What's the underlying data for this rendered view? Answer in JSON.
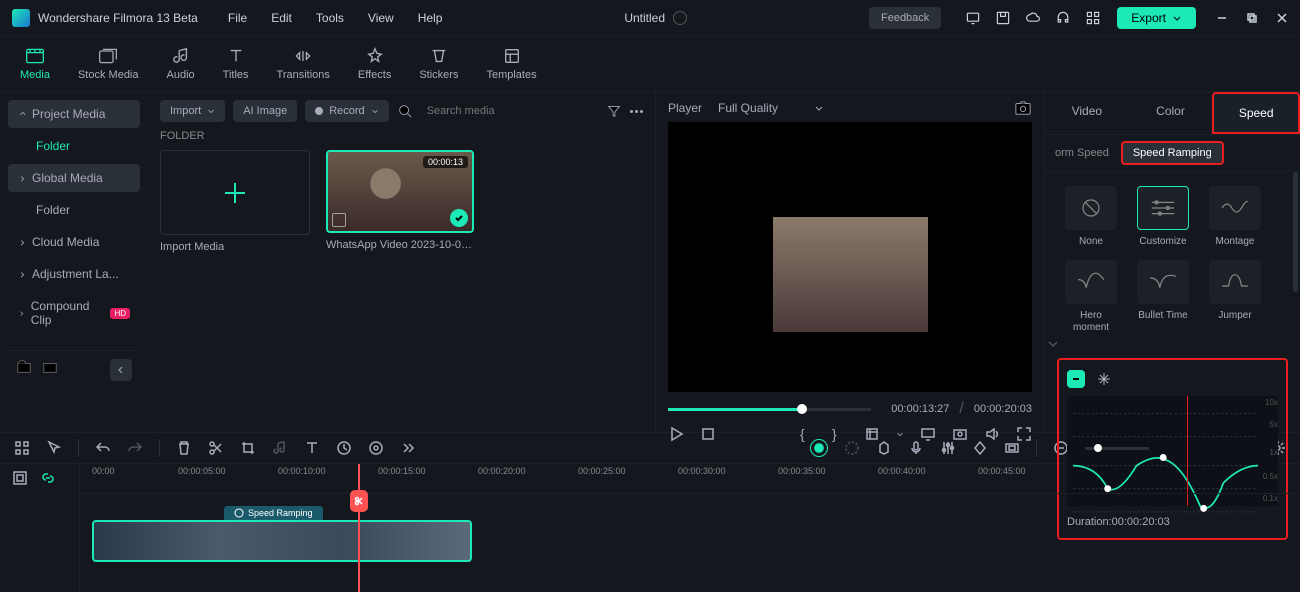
{
  "app": {
    "title": "Wondershare Filmora 13 Beta"
  },
  "menu": [
    "File",
    "Edit",
    "Tools",
    "View",
    "Help"
  ],
  "document": {
    "title": "Untitled"
  },
  "titlebar": {
    "feedback": "Feedback",
    "export": "Export"
  },
  "toolbar": {
    "items": [
      {
        "label": "Media",
        "icon": "media"
      },
      {
        "label": "Stock Media",
        "icon": "stock"
      },
      {
        "label": "Audio",
        "icon": "audio"
      },
      {
        "label": "Titles",
        "icon": "titles"
      },
      {
        "label": "Transitions",
        "icon": "transitions"
      },
      {
        "label": "Effects",
        "icon": "effects"
      },
      {
        "label": "Stickers",
        "icon": "stickers"
      },
      {
        "label": "Templates",
        "icon": "templates"
      }
    ]
  },
  "sidebar": {
    "items": [
      {
        "label": "Project Media"
      },
      {
        "label": "Folder"
      },
      {
        "label": "Global Media"
      },
      {
        "label": "Folder"
      },
      {
        "label": "Cloud Media"
      },
      {
        "label": "Adjustment La..."
      },
      {
        "label": "Compound Clip"
      }
    ]
  },
  "mediabar": {
    "import": "Import",
    "ai_image": "AI Image",
    "record": "Record",
    "search_placeholder": "Search media"
  },
  "media": {
    "folder_label": "FOLDER",
    "import_label": "Import Media",
    "clips": [
      {
        "name": "WhatsApp Video 2023-10-05...",
        "duration": "00:00:13"
      }
    ]
  },
  "player": {
    "label": "Player",
    "quality": "Full Quality",
    "current": "00:00:13:27",
    "total": "00:00:20:03"
  },
  "inspector": {
    "tabs": [
      "Video",
      "Color",
      "Speed"
    ],
    "subtab_left": "orm Speed",
    "subtab_right": "Speed Ramping",
    "presets": [
      "None",
      "Customize",
      "Montage",
      "Hero moment",
      "Bullet Time",
      "Jumper"
    ],
    "graph_labels": [
      "10x",
      "5x",
      "1x",
      "0.5x",
      "0.1x"
    ],
    "duration_label": "Duration:",
    "duration_value": "00:00:20:03"
  },
  "timeline": {
    "ruler": [
      "00:00",
      "00:00:05:00",
      "00:00:10:00",
      "00:00:15:00",
      "00:00:20:00",
      "00:00:25:00",
      "00:00:30:00",
      "00:00:35:00",
      "00:00:40:00",
      "00:00:45:00"
    ],
    "clip_tag": "Speed Ramping"
  }
}
